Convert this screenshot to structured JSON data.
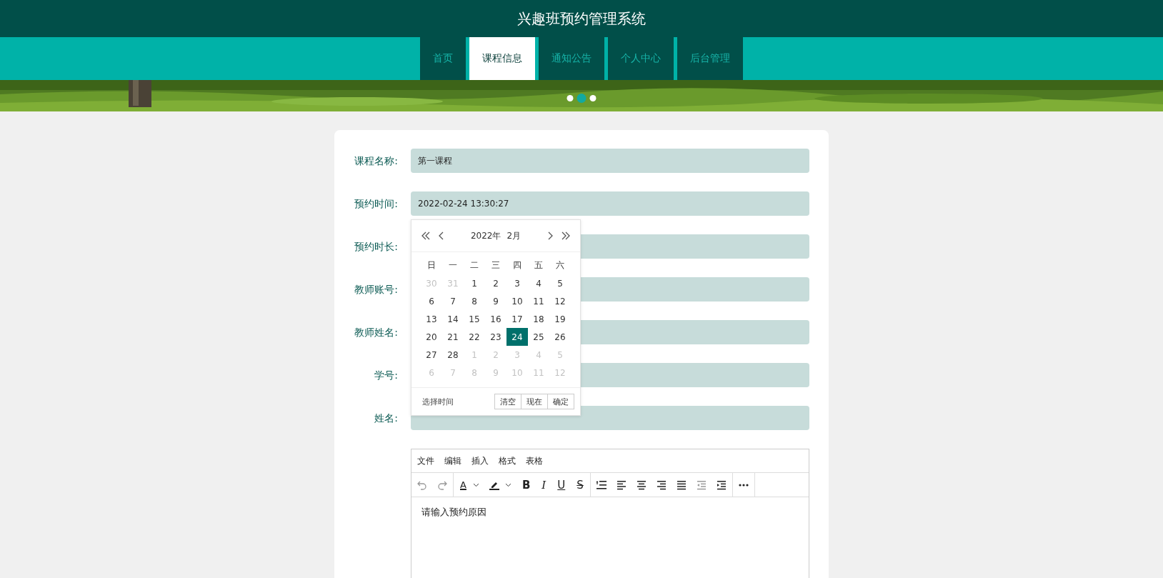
{
  "header": {
    "title": "兴趣班预约管理系统"
  },
  "nav": [
    {
      "label": "首页",
      "selected": false
    },
    {
      "label": "课程信息",
      "selected": true
    },
    {
      "label": "通知公告",
      "selected": false
    },
    {
      "label": "个人中心",
      "selected": false
    },
    {
      "label": "后台管理",
      "selected": false
    }
  ],
  "banner": {
    "kind": "picture",
    "dots": [
      {
        "selected": false
      },
      {
        "selected": true
      },
      {
        "selected": false
      }
    ]
  },
  "form": {
    "fields": [
      {
        "label": "课程名称:",
        "value": "第一课程"
      },
      {
        "label": "预约时间:",
        "value": "2022-02-24 13:30:27"
      },
      {
        "label": "预约时长:"
      },
      {
        "label": "教师账号:"
      },
      {
        "label": "教师姓名:"
      },
      {
        "label": "学号:"
      },
      {
        "label": "姓名:"
      }
    ]
  },
  "date_picker": {
    "year": "2022年",
    "month": "2月",
    "weekdays": [
      "日",
      "一",
      "二",
      "三",
      "四",
      "五",
      "六"
    ],
    "weeks": [
      [
        {
          "day": "30",
          "muted": true,
          "selected": false
        },
        {
          "day": "31",
          "muted": true,
          "selected": false
        },
        {
          "day": "1",
          "muted": false,
          "selected": false
        },
        {
          "day": "2",
          "muted": false,
          "selected": false
        },
        {
          "day": "3",
          "muted": false,
          "selected": false
        },
        {
          "day": "4",
          "muted": false,
          "selected": false
        },
        {
          "day": "5",
          "muted": false,
          "selected": false
        }
      ],
      [
        {
          "day": "6",
          "muted": false,
          "selected": false
        },
        {
          "day": "7",
          "muted": false,
          "selected": false
        },
        {
          "day": "8",
          "muted": false,
          "selected": false
        },
        {
          "day": "9",
          "muted": false,
          "selected": false
        },
        {
          "day": "10",
          "muted": false,
          "selected": false
        },
        {
          "day": "11",
          "muted": false,
          "selected": false
        },
        {
          "day": "12",
          "muted": false,
          "selected": false
        }
      ],
      [
        {
          "day": "13",
          "muted": false,
          "selected": false
        },
        {
          "day": "14",
          "muted": false,
          "selected": false
        },
        {
          "day": "15",
          "muted": false,
          "selected": false
        },
        {
          "day": "16",
          "muted": false,
          "selected": false
        },
        {
          "day": "17",
          "muted": false,
          "selected": false
        },
        {
          "day": "18",
          "muted": false,
          "selected": false
        },
        {
          "day": "19",
          "muted": false,
          "selected": false
        }
      ],
      [
        {
          "day": "20",
          "muted": false,
          "selected": false
        },
        {
          "day": "21",
          "muted": false,
          "selected": false
        },
        {
          "day": "22",
          "muted": false,
          "selected": false
        },
        {
          "day": "23",
          "muted": false,
          "selected": false
        },
        {
          "day": "24",
          "muted": false,
          "selected": true
        },
        {
          "day": "25",
          "muted": false,
          "selected": false
        },
        {
          "day": "26",
          "muted": false,
          "selected": false
        }
      ],
      [
        {
          "day": "27",
          "muted": false,
          "selected": false
        },
        {
          "day": "28",
          "muted": false,
          "selected": false
        },
        {
          "day": "1",
          "muted": true,
          "selected": false
        },
        {
          "day": "2",
          "muted": true,
          "selected": false
        },
        {
          "day": "3",
          "muted": true,
          "selected": false
        },
        {
          "day": "4",
          "muted": true,
          "selected": false
        },
        {
          "day": "5",
          "muted": true,
          "selected": false
        }
      ],
      [
        {
          "day": "6",
          "muted": true,
          "selected": false
        },
        {
          "day": "7",
          "muted": true,
          "selected": false
        },
        {
          "day": "8",
          "muted": true,
          "selected": false
        },
        {
          "day": "9",
          "muted": true,
          "selected": false
        },
        {
          "day": "10",
          "muted": true,
          "selected": false
        },
        {
          "day": "11",
          "muted": true,
          "selected": false
        },
        {
          "day": "12",
          "muted": true,
          "selected": false
        }
      ]
    ],
    "time_link": "选择时间",
    "buttons": [
      "清空",
      "现在",
      "确定"
    ]
  },
  "editor": {
    "menu": [
      "文件",
      "编辑",
      "插入",
      "格式",
      "表格"
    ],
    "toolbar": [
      [
        {
          "kind": "undo",
          "disabled": true
        },
        {
          "kind": "redo",
          "disabled": true
        }
      ],
      [
        {
          "kind": "text-color",
          "label": "A",
          "disabled": false
        },
        {
          "kind": "caret",
          "disabled": false
        },
        {
          "kind": "highlight",
          "disabled": false
        },
        {
          "kind": "caret",
          "disabled": false
        },
        {
          "kind": "bold",
          "label": "B",
          "disabled": false
        },
        {
          "kind": "italic",
          "label": "I",
          "disabled": false
        },
        {
          "kind": "underline",
          "label": "U",
          "disabled": false
        },
        {
          "kind": "strike",
          "label": "S",
          "disabled": false
        }
      ],
      [
        {
          "kind": "line-height",
          "disabled": false
        },
        {
          "kind": "align-left",
          "disabled": false
        },
        {
          "kind": "align-center",
          "disabled": false
        },
        {
          "kind": "align-right",
          "disabled": false
        },
        {
          "kind": "justify",
          "disabled": false
        },
        {
          "kind": "outdent",
          "disabled": true
        },
        {
          "kind": "indent",
          "disabled": false
        }
      ],
      [
        {
          "kind": "more",
          "disabled": false
        }
      ]
    ],
    "content": "请输入预约原因"
  }
}
